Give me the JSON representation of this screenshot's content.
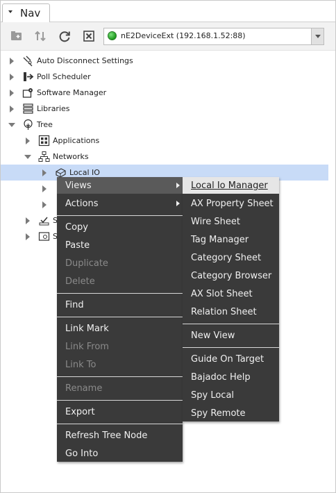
{
  "nav": {
    "tab_label": "Nav"
  },
  "toolbar": {
    "buttons": [
      "new-folder-icon",
      "sync-up-down-icon",
      "refresh-icon",
      "close-icon"
    ],
    "station_selector": {
      "value": "nE2DeviceExt (192.168.1.52:88)",
      "status_color": "#1e9a1e"
    }
  },
  "tree": {
    "items": [
      {
        "label": "Auto Disconnect Settings",
        "icon": "auto-disconnect-icon"
      },
      {
        "label": "Poll Scheduler",
        "icon": "poll-scheduler-icon"
      },
      {
        "label": "Software Manager",
        "icon": "software-manager-icon"
      },
      {
        "label": "Libraries",
        "icon": "libraries-icon"
      },
      {
        "label": "Tree",
        "icon": "tree-icon"
      },
      {
        "label": "Applications",
        "icon": "applications-icon"
      },
      {
        "label": "Networks",
        "icon": "networks-icon"
      },
      {
        "label": "Local IO",
        "icon": "local-io-icon"
      },
      {
        "label": "S",
        "icon": "service-icon"
      },
      {
        "label": "S",
        "icon": "settings-icon"
      }
    ]
  },
  "context_menu": {
    "items": [
      {
        "label": "Views",
        "submenu": true
      },
      {
        "label": "Actions",
        "submenu": true
      },
      {
        "label": "Copy"
      },
      {
        "label": "Paste"
      },
      {
        "label": "Duplicate",
        "disabled": true
      },
      {
        "label": "Delete",
        "disabled": true
      },
      {
        "label": "Find"
      },
      {
        "label": "Link Mark"
      },
      {
        "label": "Link From",
        "disabled": true
      },
      {
        "label": "Link To",
        "disabled": true
      },
      {
        "label": "Rename",
        "disabled": true
      },
      {
        "label": "Export"
      },
      {
        "label": "Refresh Tree Node"
      },
      {
        "label": "Go Into"
      }
    ]
  },
  "views_submenu": {
    "items": [
      {
        "label": "Local Io Manager"
      },
      {
        "label": "AX Property Sheet"
      },
      {
        "label": "Wire Sheet"
      },
      {
        "label": "Tag Manager"
      },
      {
        "label": "Category Sheet"
      },
      {
        "label": "Category Browser"
      },
      {
        "label": "AX Slot Sheet"
      },
      {
        "label": "Relation Sheet"
      },
      {
        "label": "New View"
      },
      {
        "label": "Guide On Target"
      },
      {
        "label": "Bajadoc Help"
      },
      {
        "label": "Spy Local"
      },
      {
        "label": "Spy Remote"
      }
    ]
  }
}
